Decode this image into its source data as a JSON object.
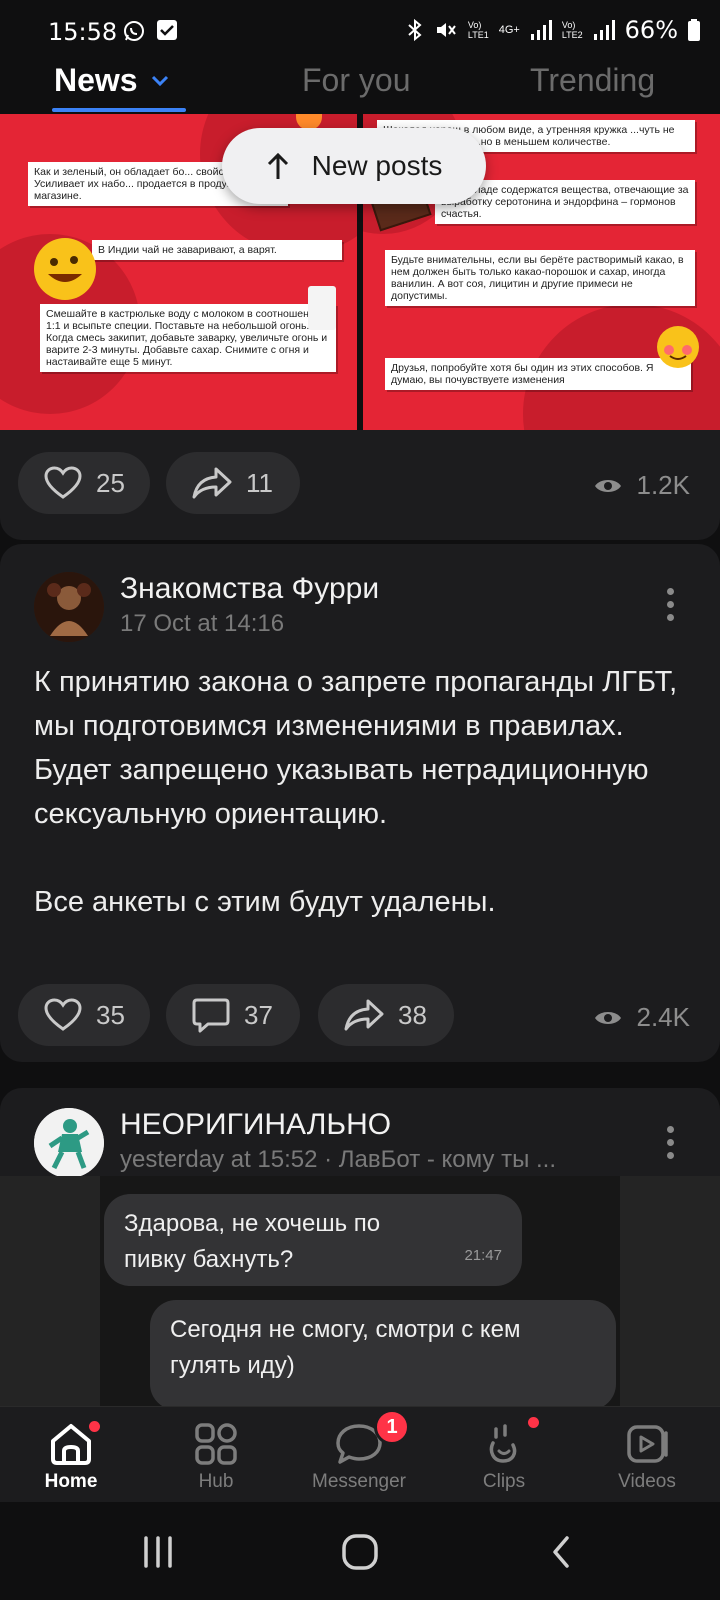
{
  "status_bar": {
    "time": "15:58",
    "battery": "66%",
    "net1": "Vo)\nLTE1",
    "net2": "4G+",
    "net3": "Vo)\nLTE2"
  },
  "tabs": [
    {
      "label": "News",
      "active": true
    },
    {
      "label": "For you",
      "active": false
    },
    {
      "label": "Trending",
      "active": false
    }
  ],
  "new_posts_label": "New posts",
  "post1": {
    "image_left_notes": [
      "Как и зеленый, он обладает бо... свойствами. Усиливает их набо... продается в продуктовом магазине.",
      "В Индии чай не заваривают, а варят.",
      "Смешайте в кастрюльке воду с молоком в соотношении 1:1 и всыпьте специи. Поставьте на небольшой огонь. Когда смесь закипит, добавьте заварку, увеличьте огонь и варите 2-3 минуты. Добавьте сахар. Снимите с огня и настаивайте еще 5 минут."
    ],
    "image_right_notes": [
      "Шоколад хорош в любом виде, а утренняя кружка ...чуть не хуже кофе. В нем ...но в меньшем количестве.",
      "...шоколаде содержатся вещества, отвечающие за выработку серотонина и эндорфина – гормонов счастья.",
      "Будьте внимательны, если вы берёте растворимый какао, в нем должен быть только какао-порошок и сахар, иногда ванилин. А вот соя, лицитин и другие примеси не допустимы.",
      "Друзья, попробуйте хотя бы один из этих способов. Я думаю, вы почувствуете изменения"
    ],
    "likes": "25",
    "shares": "11",
    "views": "1.2K"
  },
  "post2": {
    "author": "Знакомства Фурри",
    "date": "17 Oct at 14:16",
    "text": "К принятию закона о запрете пропаганды ЛГБТ, мы подготовимся изменениями в правилах. Будет запрещено указывать нетрадиционную сексуальную ориентацию.\n\nВсе анкеты с этим будут удалены.",
    "likes": "35",
    "comments": "37",
    "shares": "38",
    "views": "2.4K"
  },
  "post3": {
    "author": "НЕОРИГИНАЛЬНО",
    "meta": "yesterday at 15:52 · ЛавБот - кому ты ...",
    "bubble1": "Здарова, не хочешь по пивку бахнуть?",
    "bubble1_time": "21:47",
    "bubble2": "Сегодня не смогу, смотри с кем гулять иду)"
  },
  "bottom_nav": [
    {
      "label": "Home",
      "icon": "home-icon",
      "active": true
    },
    {
      "label": "Hub",
      "icon": "hub-grid-icon",
      "active": false
    },
    {
      "label": "Messenger",
      "icon": "messenger-icon",
      "active": false,
      "badge": "1"
    },
    {
      "label": "Clips",
      "icon": "clips-icon",
      "active": false
    },
    {
      "label": "Videos",
      "icon": "videos-icon",
      "active": false
    }
  ],
  "colors": {
    "accent": "#3b82f6",
    "background": "#0f0f10",
    "card": "#1c1c1e",
    "notification": "#ff3347",
    "image_red": "#e42535"
  }
}
